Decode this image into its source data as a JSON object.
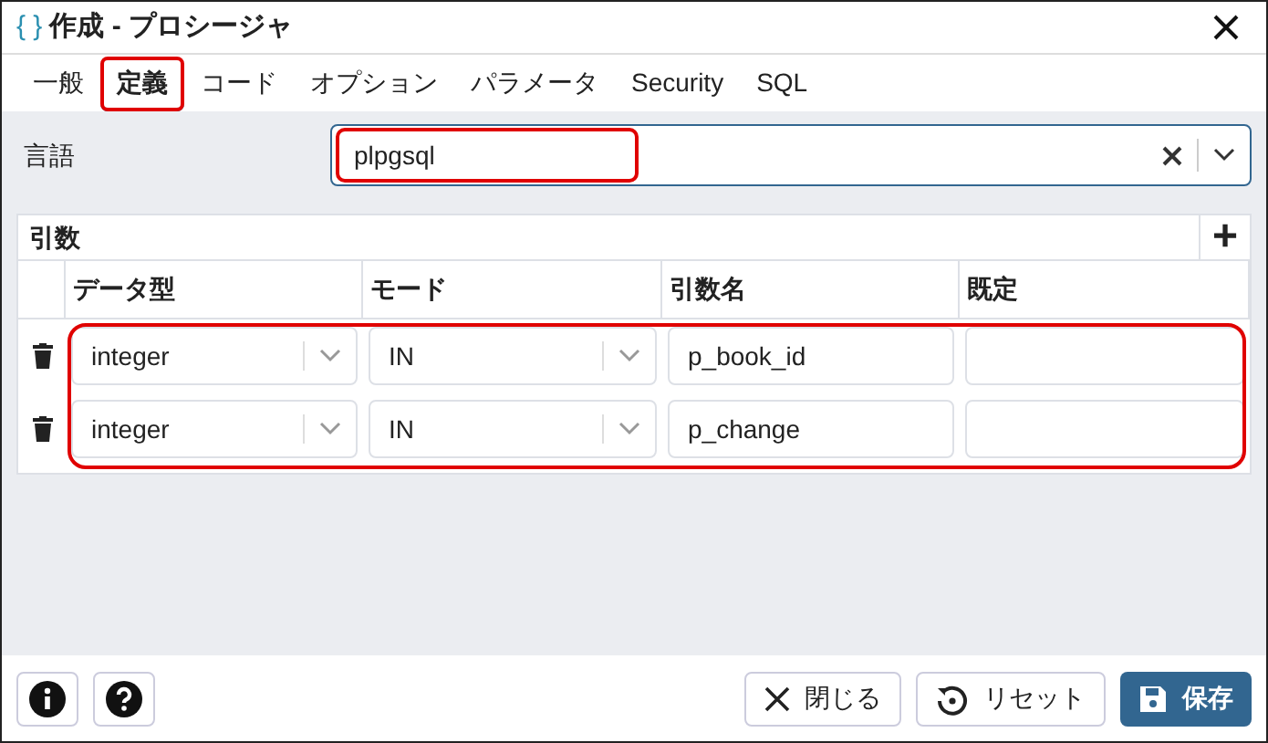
{
  "window": {
    "title": "作成 - プロシージャ",
    "icon": "{ }"
  },
  "tabs": [
    {
      "label": "一般",
      "selected": false,
      "highlighted": false
    },
    {
      "label": "定義",
      "selected": true,
      "highlighted": true
    },
    {
      "label": "コード",
      "selected": false,
      "highlighted": false
    },
    {
      "label": "オプション",
      "selected": false,
      "highlighted": false
    },
    {
      "label": "パラメータ",
      "selected": false,
      "highlighted": false
    },
    {
      "label": "Security",
      "selected": false,
      "highlighted": false
    },
    {
      "label": "SQL",
      "selected": false,
      "highlighted": false
    }
  ],
  "language": {
    "label": "言語",
    "value": "plpgsql",
    "highlighted": true
  },
  "arguments": {
    "title": "引数",
    "add_icon": "+",
    "highlighted": true,
    "columns": [
      "データ型",
      "モード",
      "引数名",
      "既定"
    ],
    "rows": [
      {
        "data_type": "integer",
        "mode": "IN",
        "name": "p_book_id"
      },
      {
        "data_type": "integer",
        "mode": "IN",
        "name": "p_change"
      }
    ]
  },
  "footer": {
    "buttons": [
      {
        "label": "閉じる",
        "kind": "close"
      },
      {
        "label": "リセット",
        "kind": "reset"
      },
      {
        "label": "保存",
        "kind": "save"
      }
    ]
  }
}
